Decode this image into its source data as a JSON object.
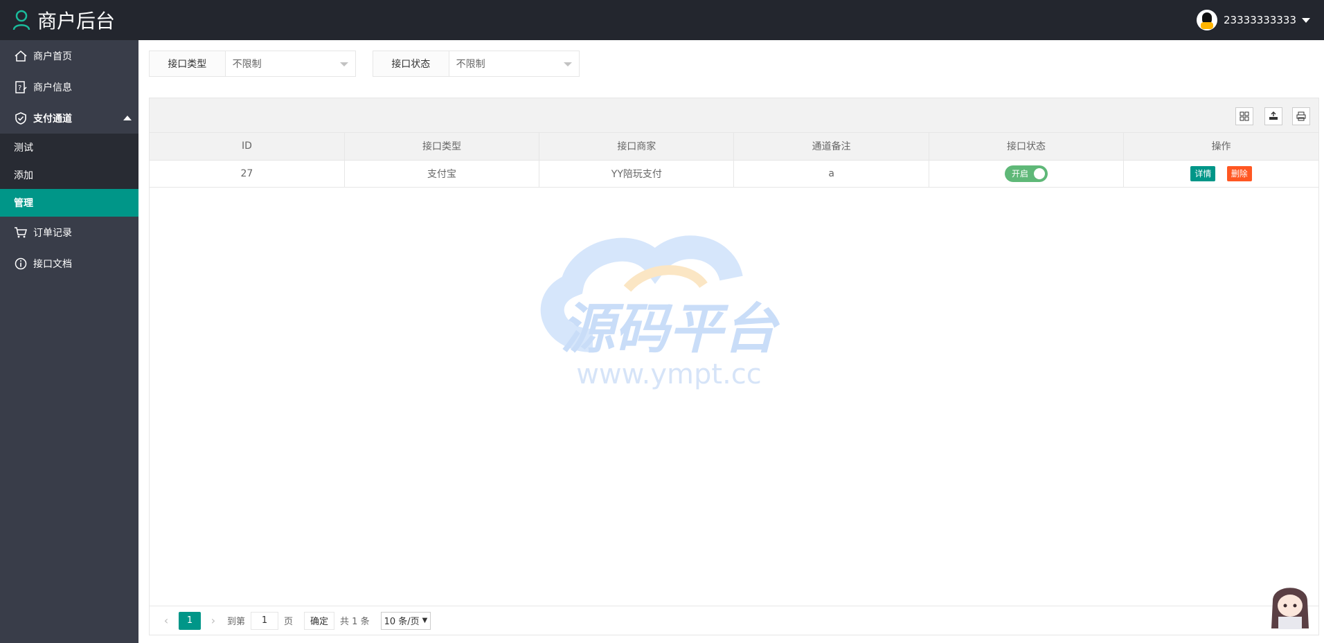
{
  "header": {
    "title": "商户后台",
    "username": "23333333333"
  },
  "sidebar": {
    "items": [
      {
        "label": "商户首页",
        "icon": "home-icon"
      },
      {
        "label": "商户信息",
        "icon": "info-edit-icon"
      },
      {
        "label": "支付通道",
        "icon": "shield-check-icon"
      },
      {
        "label": "订单记录",
        "icon": "cart-icon"
      },
      {
        "label": "接口文档",
        "icon": "info-circle-icon"
      }
    ],
    "sub_items": [
      {
        "label": "测试"
      },
      {
        "label": "添加"
      },
      {
        "label": "管理"
      }
    ]
  },
  "filters": [
    {
      "label": "接口类型",
      "value": "不限制"
    },
    {
      "label": "接口状态",
      "value": "不限制"
    }
  ],
  "table": {
    "columns": [
      "ID",
      "接口类型",
      "接口商家",
      "通道备注",
      "接口状态",
      "操作"
    ],
    "rows": [
      {
        "id": "27",
        "type": "支付宝",
        "merchant": "YY陪玩支付",
        "note": "a",
        "status": "开启",
        "detail": "详情",
        "delete": "删除"
      }
    ]
  },
  "watermark": {
    "text": "源码平台",
    "url": "www.ympt.cc"
  },
  "pager": {
    "current_page": "1",
    "goto_label": "到第",
    "goto_value": "1",
    "page_label": "页",
    "confirm_label": "确定",
    "total_label": "共 1 条",
    "page_size": "10 条/页"
  },
  "colors": {
    "header_bg": "#23262e",
    "sidebar_bg": "#393d49",
    "accent": "#009688",
    "danger": "#ff5722",
    "switch_on": "#5fb878"
  }
}
